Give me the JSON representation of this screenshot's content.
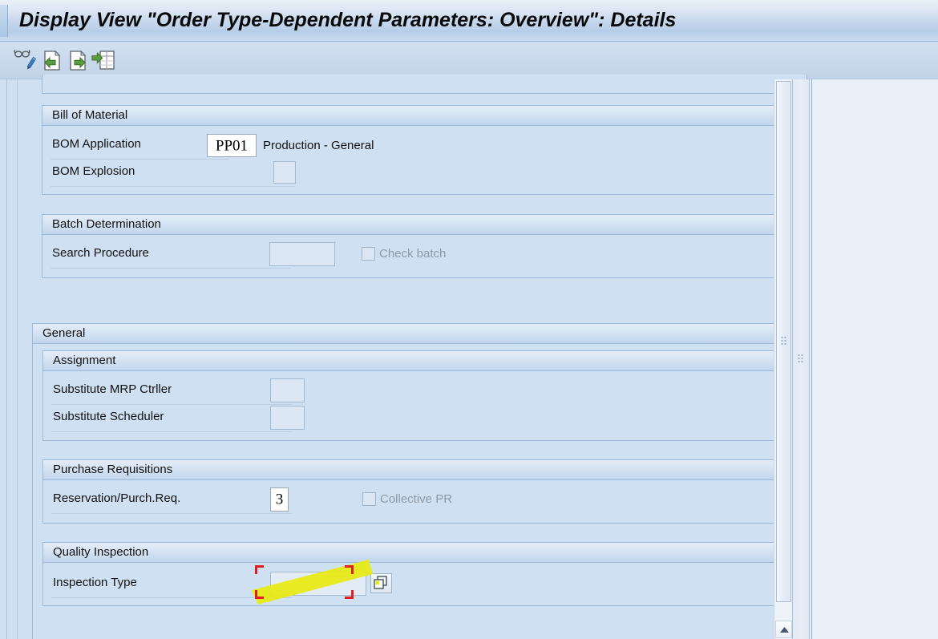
{
  "window": {
    "title": "Display View \"Order Type-Dependent Parameters: Overview\": Details"
  },
  "toolbar": {
    "buttons": [
      {
        "name": "display-change-icon",
        "tooltip": "Display <-> Change"
      },
      {
        "name": "previous-entry-icon",
        "tooltip": "Previous Entry"
      },
      {
        "name": "next-entry-icon",
        "tooltip": "Next Entry"
      },
      {
        "name": "overview-icon",
        "tooltip": "Overview"
      }
    ]
  },
  "form": {
    "groups": [
      {
        "id": "bill_of_material",
        "title": "Bill of Material",
        "fields": [
          {
            "label": "BOM Application",
            "value": "PP01",
            "suffix": "Production - General",
            "type": "display-text"
          },
          {
            "label": "BOM Explosion",
            "value": "",
            "suffix": "",
            "type": "input"
          }
        ]
      },
      {
        "id": "batch_determination",
        "title": "Batch Determination",
        "fields": [
          {
            "label": "Search Procedure",
            "value": "",
            "suffix": "",
            "type": "input",
            "checkbox": {
              "label": "Check batch",
              "checked": false,
              "disabled": true
            }
          }
        ]
      },
      {
        "id": "general",
        "title": "General",
        "level": "top",
        "subgroups": [
          {
            "id": "assignment",
            "title": "Assignment",
            "fields": [
              {
                "label": "Substitute MRP Ctrller",
                "value": "",
                "type": "input"
              },
              {
                "label": "Substitute Scheduler",
                "value": "",
                "type": "input"
              }
            ]
          },
          {
            "id": "purchase_requisitions",
            "title": "Purchase Requisitions",
            "fields": [
              {
                "label": "Reservation/Purch.Req.",
                "value": "3",
                "type": "display-text",
                "checkbox": {
                  "label": "Collective PR",
                  "checked": false,
                  "disabled": true
                }
              }
            ]
          },
          {
            "id": "quality_inspection",
            "title": "Quality Inspection",
            "fields": [
              {
                "label": "Inspection Type",
                "value": "",
                "type": "input",
                "selected": true,
                "highlighted": true,
                "value_help_icon": "multiple-selection-icon"
              }
            ]
          }
        ]
      }
    ]
  },
  "scrollbar": {
    "name": "vertical-scrollbar",
    "arrow_icon": "arrow-up-icon"
  },
  "splitter": {
    "name": "panel-splitter",
    "grip_icon": "grip-dots-icon"
  },
  "colors": {
    "selection_marker": "#e02020",
    "highlight": "#e8ea10",
    "title_text": "#0a0a0a",
    "group_border": "#9bbada",
    "background": "#cfe0f2"
  }
}
